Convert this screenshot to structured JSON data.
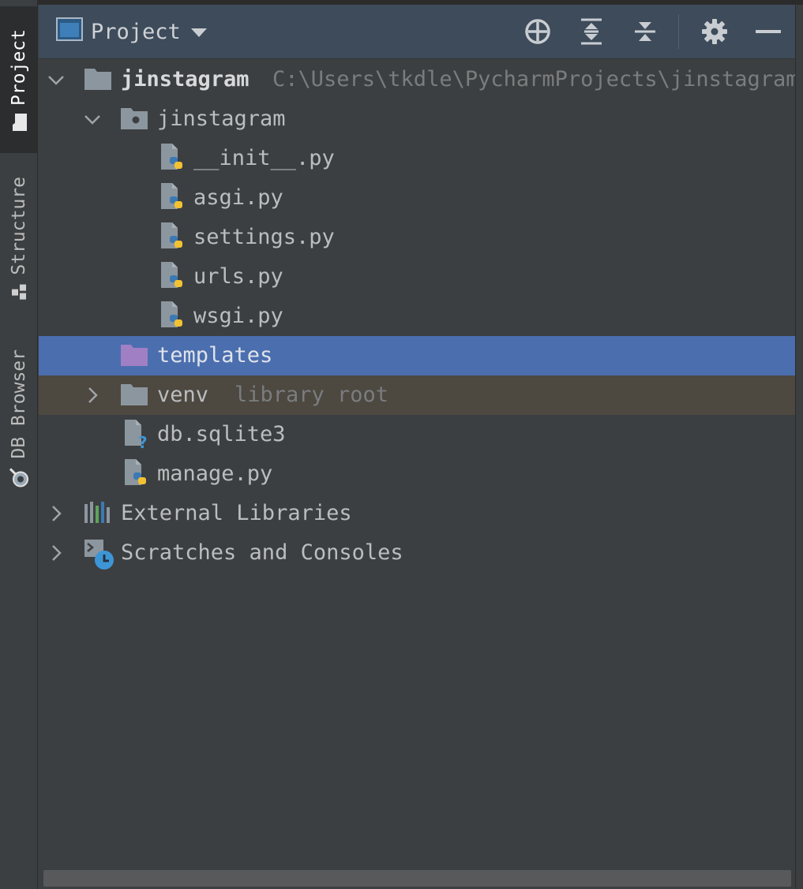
{
  "sidebar": {
    "tabs": [
      {
        "label": "Project",
        "icon": "folder-icon",
        "active": true
      },
      {
        "label": "Structure",
        "icon": "structure-icon",
        "active": false
      },
      {
        "label": "DB Browser",
        "icon": "db-browser-icon",
        "active": false
      }
    ]
  },
  "header": {
    "title": "Project",
    "view_icon": "project-view-icon",
    "dropdown_icon": "chevron-down-icon",
    "actions": [
      "locate-icon",
      "expand-all-icon",
      "collapse-all-icon",
      "gear-icon",
      "minimize-icon"
    ]
  },
  "tree": {
    "root": {
      "name": "jinstagram",
      "path": "C:\\Users\\tkdle\\PycharmProjects\\jinstagram",
      "expanded": true
    },
    "package": {
      "name": "jinstagram",
      "expanded": true
    },
    "files": [
      "__init__.py",
      "asgi.py",
      "settings.py",
      "urls.py",
      "wsgi.py"
    ],
    "templates": {
      "name": "templates",
      "selected": true
    },
    "venv": {
      "name": "venv",
      "hint": "library root"
    },
    "db": {
      "name": "db.sqlite3"
    },
    "manage": {
      "name": "manage.py"
    },
    "external": {
      "name": "External Libraries"
    },
    "scratches": {
      "name": "Scratches and Consoles"
    }
  },
  "colors": {
    "background": "#3c3f41",
    "header": "#3d4b5a",
    "selection": "#4b6eaf",
    "library_row": "#4d4840",
    "folder": "#8c969e",
    "templates_folder": "#a07fc4",
    "python_blue": "#3b79b4",
    "python_yellow": "#f2c233"
  }
}
